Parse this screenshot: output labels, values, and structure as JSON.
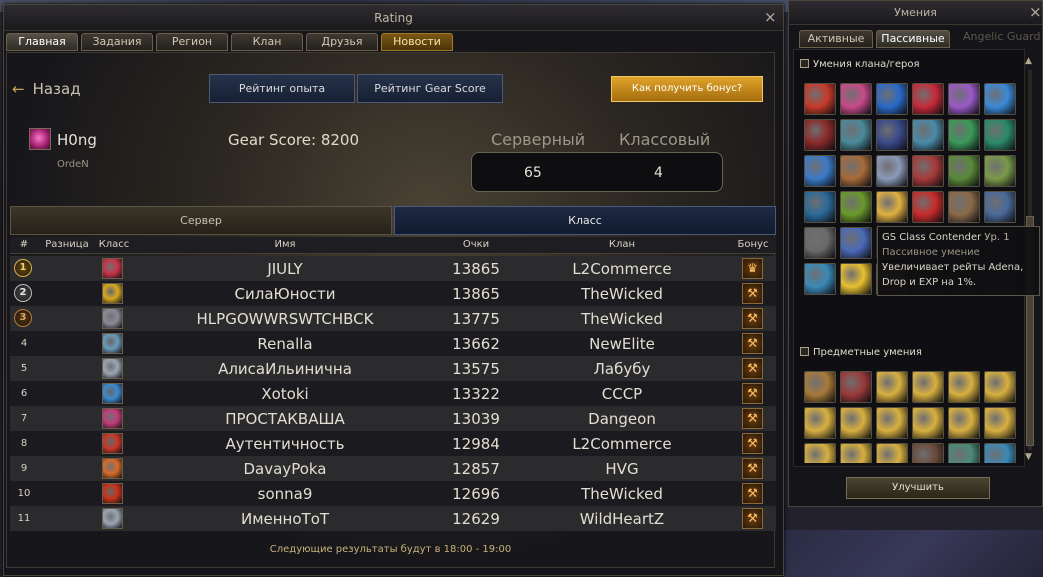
{
  "main_window": {
    "title": "Rating",
    "close_glyph": "×",
    "tabs": [
      {
        "label": "Главная"
      },
      {
        "label": "Задания"
      },
      {
        "label": "Регион"
      },
      {
        "label": "Клан"
      },
      {
        "label": "Друзья"
      },
      {
        "label": "Новости"
      }
    ],
    "back_label": "Назад",
    "rating_exp_label": "Рейтинг опыта",
    "rating_gs_label": "Рейтинг Gear Score",
    "bonus_button_label": "Как получить бонус?",
    "player": {
      "name": "H0ng",
      "clan": "OrdeN",
      "gear_score": "Gear Score: 8200"
    },
    "rank": {
      "server_label": "Серверный",
      "class_label": "Классовый",
      "server_value": "65",
      "class_value": "4"
    },
    "segments": {
      "server": "Сервер",
      "class": "Класс"
    },
    "columns": {
      "rank": "#",
      "diff": "Разница",
      "klass": "Класс",
      "name": "Имя",
      "points": "Очки",
      "clan": "Клан",
      "bonus": "Бонус"
    },
    "rows": [
      {
        "rank": "1",
        "name": "JIULY",
        "points": "13865",
        "clan": "L2Commerce",
        "medal": "gold",
        "class_color": "#c8324a",
        "bonus_icon": "crown-icon"
      },
      {
        "rank": "2",
        "name": "СилаЮности",
        "points": "13865",
        "clan": "TheWicked",
        "medal": "silver",
        "class_color": "#d8a820",
        "bonus_icon": "axe-icon"
      },
      {
        "rank": "3",
        "name": "HLPGOWWRSWTCHBCK",
        "points": "13775",
        "clan": "TheWicked",
        "medal": "bronze",
        "class_color": "#8a8a9a",
        "bonus_icon": "axe-icon"
      },
      {
        "rank": "4",
        "name": "Renalla",
        "points": "13662",
        "clan": "NewElite",
        "medal": "",
        "class_color": "#6a9ab8",
        "bonus_icon": "axe-icon"
      },
      {
        "rank": "5",
        "name": "АлисаИльинична",
        "points": "13575",
        "clan": "Лабубу",
        "medal": "",
        "class_color": "#9aa6b4",
        "bonus_icon": "axe-icon"
      },
      {
        "rank": "6",
        "name": "Xotoki",
        "points": "13322",
        "clan": "СССР",
        "medal": "",
        "class_color": "#3a8ad0",
        "bonus_icon": "axe-icon"
      },
      {
        "rank": "7",
        "name": "ПРОСТАКВАША",
        "points": "13039",
        "clan": "Dangeon",
        "medal": "",
        "class_color": "#c23a7a",
        "bonus_icon": "axe-icon"
      },
      {
        "rank": "8",
        "name": "Аутентичность",
        "points": "12984",
        "clan": "L2Commerce",
        "medal": "",
        "class_color": "#c83828",
        "bonus_icon": "axe-icon"
      },
      {
        "rank": "9",
        "name": "DavayPoka",
        "points": "12857",
        "clan": "HVG",
        "medal": "",
        "class_color": "#d86a2a",
        "bonus_icon": "axe-icon"
      },
      {
        "rank": "10",
        "name": "sonna9",
        "points": "12696",
        "clan": "TheWicked",
        "medal": "",
        "class_color": "#c8321a",
        "bonus_icon": "axe-icon"
      },
      {
        "rank": "11",
        "name": "ИменноТоТ",
        "points": "12629",
        "clan": "WildHeartZ",
        "medal": "",
        "class_color": "#9aa6b4",
        "bonus_icon": "axe-icon"
      }
    ],
    "footer_text": "Следующие результаты будут в 18:00 - 19:00"
  },
  "skills_window": {
    "title": "Умения",
    "close_glyph": "×",
    "tab_active": "Активные",
    "tab_passive": "Пассивные",
    "ghost_text": "Angelic Guard",
    "section_clan": "Умения клана/героя",
    "section_items": "Предметные умения",
    "upgrade_label": "Улучшить",
    "tooltip": {
      "name": "GS Class Contender",
      "level": "Ур. 1",
      "type": "Пассивное умение",
      "description": "Увеличивает рейты Adena, Drop и EXP на 1%."
    },
    "clan_icons": [
      "#c83a2a",
      "#c84a8a",
      "#2a6ac8",
      "#c82a3a",
      "#9a5ac8",
      "#3a8ad8",
      "#8a2a2a",
      "#4a8a9a",
      "#3a4a8a",
      "#4a8aa8",
      "#3a9a5a",
      "#2a8a6a",
      "#3a7ac8",
      "#a86a3a",
      "#8a9ab8",
      "#a83a3a",
      "#5a8a3a",
      "#7a9a4a",
      "#2a6a9a",
      "#6a9a2a",
      "#e0b040",
      "#c82a2a",
      "#8a6a4a",
      "#4a6a9a",
      "#6a6a6a",
      "#4a6ab8",
      "",
      "",
      " ",
      " ",
      "#3a8ab8",
      "#e8c030",
      "#6a3a2a",
      "",
      "",
      ""
    ],
    "item_icons": [
      "#a87a3a",
      "#9a3a3a",
      "#d8b040",
      "#d8b040",
      "#d8b040",
      "#d8b040",
      "#d8b040",
      "#d8b040",
      "#d8b040",
      "#d8b040",
      "#d8b040",
      "#d8b040",
      "#d8b040",
      "#d8b040",
      "#d8b040",
      "#6a4a3a",
      "#4a8a7a",
      "#3a8ab8"
    ]
  }
}
